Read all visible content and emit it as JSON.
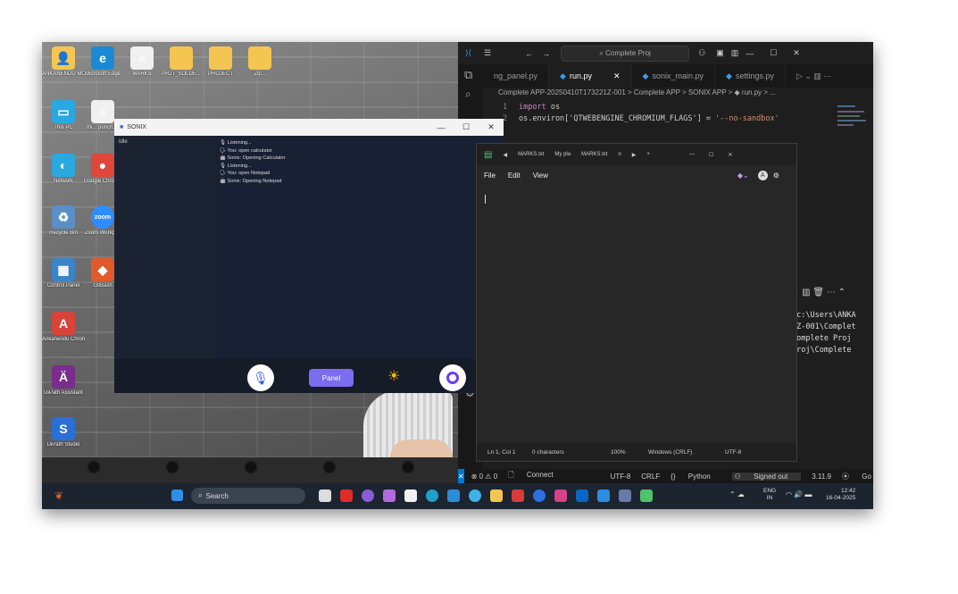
{
  "desktop": {
    "icons": [
      {
        "label": "ANKANENDU MONDAL",
        "glyph": "👤",
        "color": "#f4c550"
      },
      {
        "label": "Microsoft Edge",
        "glyph": "e",
        "color": "#1b8ad4"
      },
      {
        "label": "MARKS",
        "glyph": "≡",
        "color": "#f0f0f0"
      },
      {
        "label": "PRJT_SOLUE...",
        "glyph": "",
        "color": "#f4c550"
      },
      {
        "label": "PROJECT",
        "glyph": "",
        "color": "#f4c550"
      },
      {
        "label": "Zip...",
        "glyph": "",
        "color": "#f4c550"
      },
      {
        "label": "This PC",
        "glyph": "▭",
        "color": "#2aa8e0"
      },
      {
        "label": "mi... punch.dt",
        "glyph": "≡",
        "color": "#f0f0f0"
      },
      {
        "label": "Network",
        "glyph": "◐",
        "color": "#2aa8e0"
      },
      {
        "label": "Google Chrome",
        "glyph": "●",
        "color": "#e0463a"
      },
      {
        "label": "Recycle Bin",
        "glyph": "♻",
        "color": "#5a8fc7"
      },
      {
        "label": "Zoom Workpl...",
        "glyph": "zoom",
        "color": "#2d8cff"
      },
      {
        "label": "Control Panel",
        "glyph": "▦",
        "color": "#3a84c9"
      },
      {
        "label": "GitBash",
        "glyph": "◆",
        "color": "#e05a2b"
      },
      {
        "label": "Ankanendu Chrome",
        "glyph": "A",
        "color": "#d9443a"
      },
      {
        "label": "UiPath Assistant",
        "glyph": "Ä",
        "color": "#7a2d8c"
      },
      {
        "label": "UiPath Studio",
        "glyph": "S",
        "color": "#2b6fd6"
      }
    ]
  },
  "sonix": {
    "title": "SONIX",
    "status": "Idle",
    "log": [
      "🎙 Listening...",
      "🗣 You: open calculator",
      "🤖 Sonix: Opening Calculator",
      "🎙 Listening...",
      "🗣 You: open Notepad",
      "🤖 Sonix: Opening Notepad"
    ],
    "panel_label": "Panel",
    "controls": {
      "min": "—",
      "max": "☐",
      "close": "✕"
    }
  },
  "vscode": {
    "search": "⌕ Complete Proj",
    "tabs": [
      "ng_panel.py",
      "run.py",
      "sonix_main.py",
      "settings.py"
    ],
    "active_tab": "run.py",
    "breadcrumb": "Complete APP-20250410T173221Z-001 > Complete APP > SONIX APP > ◆ run.py > ...",
    "code": [
      {
        "n": "1",
        "kw": "import",
        "rest": " os",
        "str": ""
      },
      {
        "n": "2",
        "kw": "",
        "rest": "os.environ['QTWEBENGINE_CHROMIUM_FLAGS'] = ",
        "str": "'--no-sandbox'"
      }
    ],
    "terminal": [
      "\"c:\\Users\\ANKA",
      "1Z-001\\Complet",
      "",
      "Complete Proj",
      "Proj\\Complete"
    ],
    "status": {
      "errors": "⊗ 0 ⚠ 0",
      "connect": "Connect",
      "encoding": "UTF-8",
      "eol": "CRLF",
      "language": "Python",
      "account": "Signed out",
      "version": "3.11.9",
      "golive": "Go Live"
    }
  },
  "notepad": {
    "tabs": [
      "MARKS.txt",
      "My pla",
      "MARKS.txt",
      "n"
    ],
    "menu": [
      "File",
      "Edit",
      "View"
    ],
    "status": {
      "position": "Ln 1, Col 1",
      "chars": "0 characters",
      "zoom": "100%",
      "eol": "Windows (CRLF)",
      "encoding": "UTF-8"
    }
  },
  "taskbar": {
    "search_placeholder": "Search",
    "lang_top": "ENG",
    "lang_bottom": "IN",
    "time": "12:42",
    "date": "16-04-2025"
  }
}
